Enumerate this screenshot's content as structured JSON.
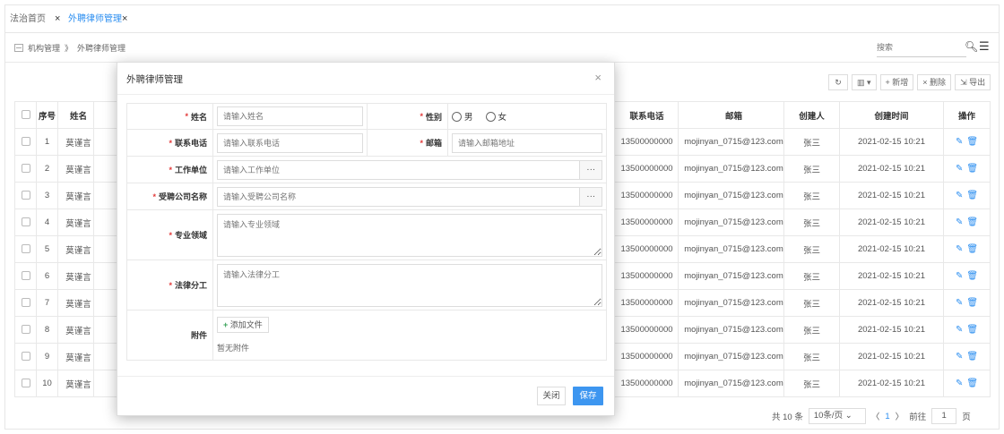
{
  "tabs": [
    {
      "label": "法治首页",
      "close": "×"
    },
    {
      "label": "外聘律师管理",
      "close": "×"
    }
  ],
  "breadcrumb": {
    "root": "机构管理",
    "sep": "》",
    "current": "外聘律师管理"
  },
  "search": {
    "placeholder": "搜索",
    "icon": "search-icon",
    "menu_icon": "list-menu-icon"
  },
  "toolbar": {
    "refresh": "↻",
    "columns": "▥ ▾",
    "add": "+ 新增",
    "delete": "× 删除",
    "export": "⇲ 导出"
  },
  "table": {
    "left_headers": [
      "序号",
      "姓名"
    ],
    "right_headers": [
      "联系电话",
      "邮箱",
      "创建人",
      "创建时间",
      "操作"
    ],
    "rows": [
      {
        "no": "1",
        "name": "莫谨言",
        "phone": "13500000000",
        "email": "mojinyan_0715@123.com",
        "creator": "张三",
        "time": "2021-02-15 10:21"
      },
      {
        "no": "2",
        "name": "莫谨言",
        "phone": "13500000000",
        "email": "mojinyan_0715@123.com",
        "creator": "张三",
        "time": "2021-02-15 10:21"
      },
      {
        "no": "3",
        "name": "莫谨言",
        "phone": "13500000000",
        "email": "mojinyan_0715@123.com",
        "creator": "张三",
        "time": "2021-02-15 10:21"
      },
      {
        "no": "4",
        "name": "莫谨言",
        "phone": "13500000000",
        "email": "mojinyan_0715@123.com",
        "creator": "张三",
        "time": "2021-02-15 10:21"
      },
      {
        "no": "5",
        "name": "莫谨言",
        "phone": "13500000000",
        "email": "mojinyan_0715@123.com",
        "creator": "张三",
        "time": "2021-02-15 10:21"
      },
      {
        "no": "6",
        "name": "莫谨言",
        "phone": "13500000000",
        "email": "mojinyan_0715@123.com",
        "creator": "张三",
        "time": "2021-02-15 10:21"
      },
      {
        "no": "7",
        "name": "莫谨言",
        "phone": "13500000000",
        "email": "mojinyan_0715@123.com",
        "creator": "张三",
        "time": "2021-02-15 10:21"
      },
      {
        "no": "8",
        "name": "莫谨言",
        "phone": "13500000000",
        "email": "mojinyan_0715@123.com",
        "creator": "张三",
        "time": "2021-02-15 10:21"
      },
      {
        "no": "9",
        "name": "莫谨言",
        "phone": "13500000000",
        "email": "mojinyan_0715@123.com",
        "creator": "张三",
        "time": "2021-02-15 10:21"
      },
      {
        "no": "10",
        "name": "莫谨言",
        "phone": "13500000000",
        "email": "mojinyan_0715@123.com",
        "creator": "张三",
        "time": "2021-02-15 10:21"
      }
    ]
  },
  "pager": {
    "total": "共 10 条",
    "size": "10条/页",
    "prev": "〈",
    "current": "1",
    "next": "〉",
    "goto": "前往",
    "page": "1",
    "unit": "页"
  },
  "modal": {
    "title": "外聘律师管理",
    "close": "×",
    "fields": {
      "name": {
        "label": "姓名",
        "placeholder": "请输入姓名"
      },
      "gender": {
        "label": "性别",
        "options": [
          "男",
          "女"
        ]
      },
      "phone": {
        "label": "联系电话",
        "placeholder": "请输入联系电话"
      },
      "email": {
        "label": "邮箱",
        "placeholder": "请输入邮箱地址"
      },
      "workunit": {
        "label": "工作单位",
        "placeholder": "请输入工作单位"
      },
      "company": {
        "label": "受聘公司名称",
        "placeholder": "请输入受聘公司名称"
      },
      "field": {
        "label": "专业领域",
        "placeholder": "请输入专业领域"
      },
      "division": {
        "label": "法律分工",
        "placeholder": "请输入法律分工"
      },
      "attach": {
        "label": "附件",
        "add": "添加文件",
        "empty": "暂无附件"
      }
    },
    "required_mark": "*",
    "ellipsis": "···",
    "close_btn": "关闭",
    "save_btn": "保存"
  },
  "colors": {
    "accent": "#3d96f0",
    "required": "#e23a3a"
  }
}
